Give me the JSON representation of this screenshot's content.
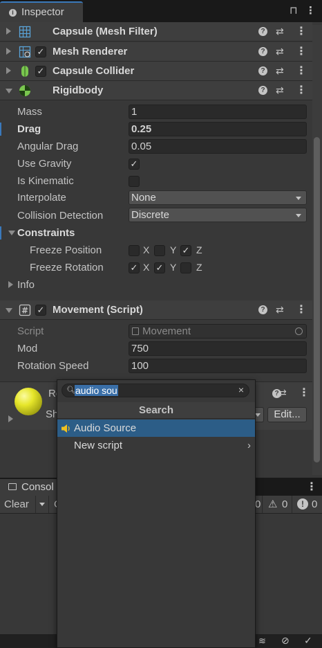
{
  "inspector": {
    "tab_title": "Inspector",
    "lock_icon": "lock-icon",
    "menu_icon": "kebab-menu-icon"
  },
  "components": {
    "mesh_filter": {
      "title": "Capsule (Mesh Filter)",
      "icon": "grid-mesh-icon"
    },
    "mesh_renderer": {
      "title": "Mesh Renderer",
      "icon": "mesh-renderer-icon",
      "enabled": true
    },
    "capsule_collider": {
      "title": "Capsule Collider",
      "icon": "capsule-collider-icon",
      "enabled": true
    },
    "rigidbody": {
      "title": "Rigidbody",
      "icon": "rigidbody-icon",
      "props": {
        "mass_label": "Mass",
        "mass_value": "1",
        "drag_label": "Drag",
        "drag_value": "0.25",
        "angular_drag_label": "Angular Drag",
        "angular_drag_value": "0.05",
        "use_gravity_label": "Use Gravity",
        "use_gravity": true,
        "is_kinematic_label": "Is Kinematic",
        "is_kinematic": false,
        "interpolate_label": "Interpolate",
        "interpolate_value": "None",
        "collision_label": "Collision Detection",
        "collision_value": "Discrete",
        "constraints_label": "Constraints",
        "freeze_position_label": "Freeze Position",
        "freeze_rotation_label": "Freeze Rotation",
        "axis_x": "X",
        "axis_y": "Y",
        "axis_z": "Z",
        "freeze_position": {
          "x": false,
          "y": false,
          "z": true
        },
        "freeze_rotation": {
          "x": true,
          "y": true,
          "z": false
        },
        "info_label": "Info"
      }
    },
    "movement": {
      "title": "Movement (Script)",
      "icon": "script-hash-icon",
      "enabled": true,
      "props": {
        "script_label": "Script",
        "script_value": "Movement",
        "mod_label": "Mod",
        "mod_value": "750",
        "rotation_speed_label": "Rotation Speed",
        "rotation_speed_value": "100"
      }
    },
    "material": {
      "name_partial": "Re",
      "shader_partial": "Sh",
      "edit_label": "Edit..."
    }
  },
  "console": {
    "tab_title": "Consol",
    "clear_label": "Clear",
    "clear_partial": "C",
    "log_count_partial": "0",
    "warn_count": "0",
    "error_count": "0"
  },
  "popup": {
    "search_value": "audio sou",
    "header": "Search",
    "items": [
      {
        "label": "Audio Source",
        "icon": "audio-source-icon",
        "selected": true
      },
      {
        "label": "New script",
        "has_submenu": true
      }
    ]
  },
  "colors": {
    "accent": "#3a79bb",
    "selection": "#2c5d87",
    "panel": "#383838"
  }
}
